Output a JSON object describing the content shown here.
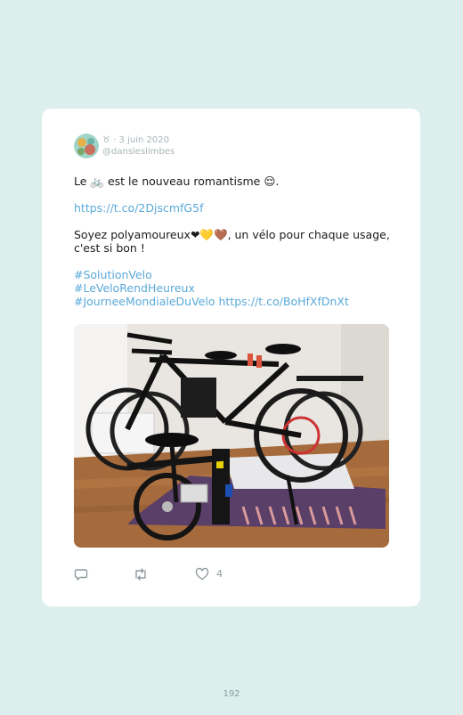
{
  "tweet": {
    "author_glyph": "♉",
    "date": "3 juin 2020",
    "handle": "@dansleslimbes",
    "line1_prefix": "Le",
    "bike_emoji": "🚲",
    "line1_suffix": "est le nouveau romantisme",
    "smile_emoji": "😌",
    "line1_end": ".",
    "link1": "https://t.co/2DjscmfG5f",
    "line2_prefix": "Soyez polyamoureux",
    "hearts": "❤💛🤎",
    "line2_suffix": ", un vélo pour chaque usage, c'est si bon !",
    "hashtag1": "#SolutionVelo",
    "hashtag2": "#LeVeloRendHeureux",
    "hashtag3": "#JourneeMondialeDuVelo",
    "link2": "https://t.co/BoHfXfDnXt",
    "like_count": "4"
  },
  "page": {
    "number": "192"
  },
  "colors": {
    "background": "#dcefed",
    "card": "#ffffff",
    "link": "#5aa9d9",
    "muted": "#a9b4b8"
  },
  "icons": [
    "reply-icon",
    "retweet-icon",
    "like-icon"
  ]
}
